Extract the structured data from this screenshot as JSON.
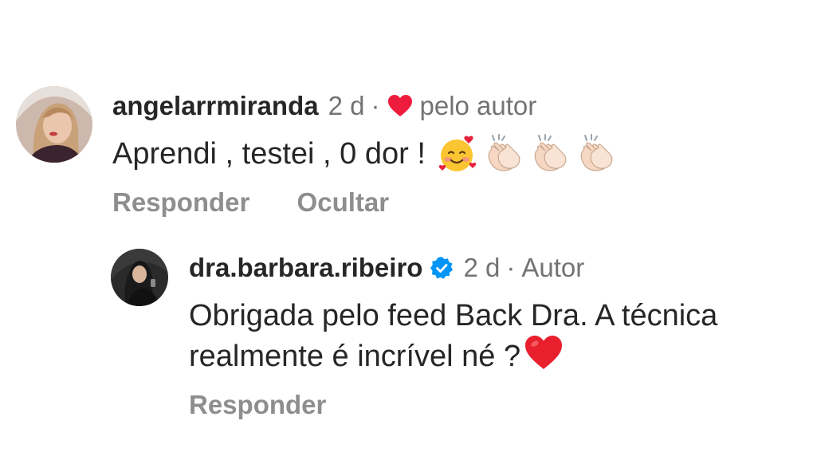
{
  "comment": {
    "username": "angelarrmiranda",
    "age": "2 d",
    "separator": "·",
    "liked_by_author": "pelo autor",
    "text": "Aprendi , testei , 0 dor !",
    "emojis": [
      "smiling-face-with-hearts",
      "clapping-hands",
      "clapping-hands",
      "clapping-hands"
    ],
    "actions": {
      "reply": "Responder",
      "hide": "Ocultar"
    }
  },
  "reply": {
    "username": "dra.barbara.ribeiro",
    "verified": true,
    "age": "2 d",
    "separator": "·",
    "role": "Autor",
    "text_line1": "Obrigada pelo feed Back Dra. A técnica",
    "text_line2": "realmente é incrível né ?",
    "trailing_emoji": "red-heart",
    "actions": {
      "reply": "Responder"
    }
  },
  "colors": {
    "text": "#262626",
    "secondary": "#737373",
    "action": "#8e8e8e",
    "heart": "#ed1c3c",
    "verified": "#0095f6"
  }
}
